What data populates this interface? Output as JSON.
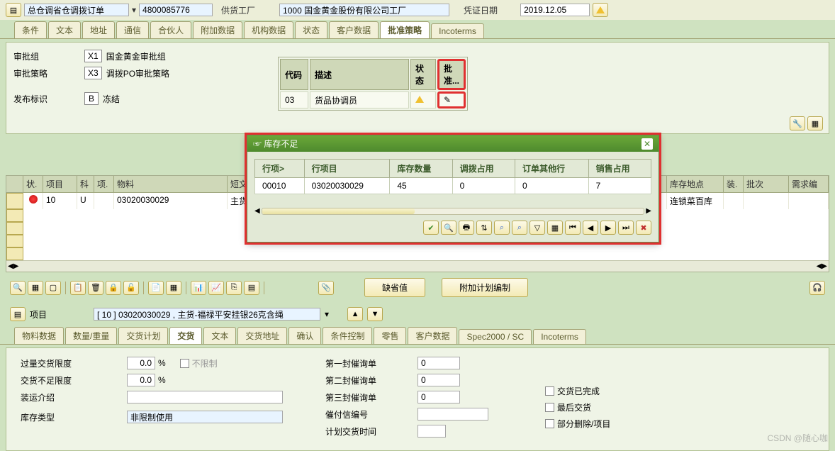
{
  "header": {
    "docTypeLabel": "总仓调省仓调拨订单",
    "docNumber": "4800085776",
    "supplyPlantLabel": "供货工厂",
    "plantCode": "1000 国金黄金股份有限公司工厂",
    "docDateLabel": "凭证日期",
    "docDate": "2019.12.05"
  },
  "tabsTop": [
    "条件",
    "文本",
    "地址",
    "通信",
    "合伙人",
    "附加数据",
    "机构数据",
    "状态",
    "客户数据",
    "批准策略",
    "Incoterms"
  ],
  "tabsTopActive": "批准策略",
  "approvalPanel": {
    "group": {
      "label": "审批组",
      "code": "X1",
      "desc": "国金黄金审批组"
    },
    "strategy": {
      "label": "审批策略",
      "code": "X3",
      "desc": "调拨PO审批策略"
    },
    "release": {
      "label": "发布标识",
      "code": "B",
      "desc": "冻结"
    }
  },
  "approvalTable": {
    "headers": [
      "代码",
      "描述",
      "状态",
      "批准..."
    ],
    "row": {
      "code": "03",
      "desc": "货品协调员"
    }
  },
  "mainGrid": {
    "headers": [
      "状.",
      "项目",
      "科",
      "项.",
      "物料",
      "短文本",
      "库存地点",
      "装.",
      "批次",
      "需求编"
    ],
    "row": {
      "item": "10",
      "acct": "U",
      "material": "03020030029",
      "shortText": "主货-福",
      "location": "连锁菜百库"
    }
  },
  "dialog": {
    "title": "库存不足",
    "headers": [
      "行项>",
      "行项目",
      "库存数量",
      "调拨占用",
      "订单其他行",
      "销售占用"
    ],
    "row": {
      "line": "00010",
      "item": "03020030029",
      "stock": "45",
      "transfer": "0",
      "other": "0",
      "sales": "7"
    }
  },
  "bottomButtons": {
    "default": "缺省值",
    "plan": "附加计划编制"
  },
  "itemSelector": {
    "label": "项目",
    "value": "[ 10 ] 03020030029 , 主货-福禄平安挂银26克含绳"
  },
  "tabsBottom": [
    "物料数据",
    "数量/重量",
    "交货计划",
    "交货",
    "文本",
    "交货地址",
    "确认",
    "条件控制",
    "零售",
    "客户数据",
    "Spec2000 / SC",
    "Incoterms"
  ],
  "tabsBottomActive": "交货",
  "delivery": {
    "overLabel": "过量交货限度",
    "overVal": "0.0",
    "overUnit": "%",
    "unlimited": "不限制",
    "underLabel": "交货不足限度",
    "underVal": "0.0",
    "underUnit": "%",
    "shipLabel": "装运介绍",
    "stockTypeLabel": "库存类型",
    "stockTypeVal": "非限制使用",
    "dun1": "第一封催询单",
    "dun2": "第二封催询单",
    "dun3": "第三封催询单",
    "dunVal": "0",
    "dunMsg": "催付信编号",
    "planTime": "计划交货时间",
    "chkDone": "交货已完成",
    "chkLast": "最后交货",
    "chkPartial": "部分删除/项目"
  },
  "watermark": "CSDN @随心咖"
}
